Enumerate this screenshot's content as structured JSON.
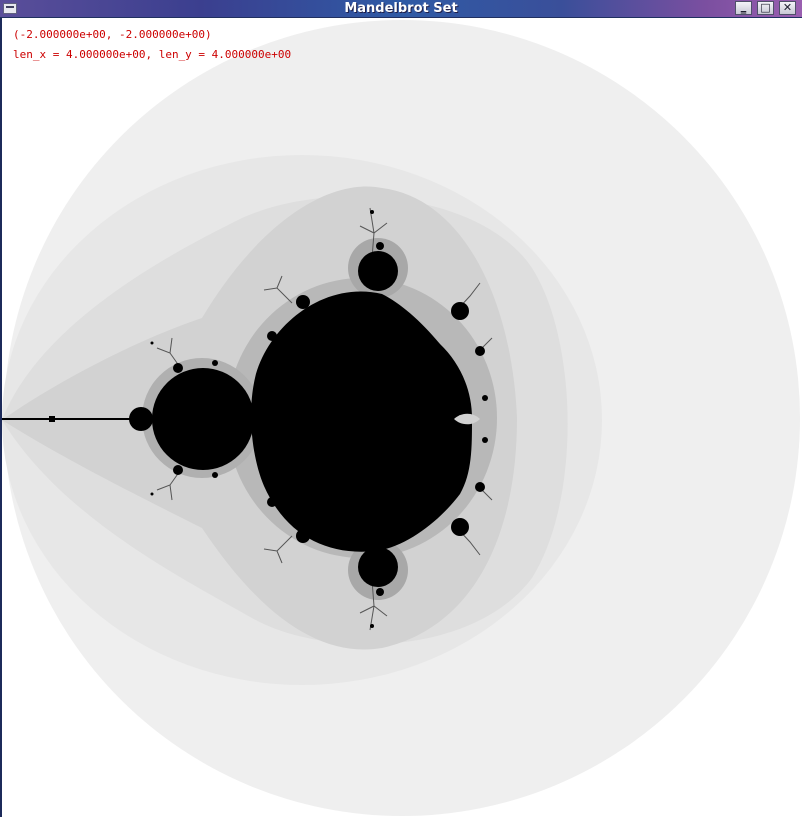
{
  "window": {
    "title": "Mandelbrot Set",
    "controls": {
      "minimize": "‗",
      "maximize": "□",
      "close": "✕"
    }
  },
  "overlay": {
    "origin": "(-2.000000e+00, -2.000000e+00)",
    "extent": "len_x = 4.000000e+00, len_y = 4.000000e+00"
  },
  "colors": {
    "overlay_text": "#cc0000",
    "set_fill": "#000000",
    "background": "#ffffff"
  }
}
